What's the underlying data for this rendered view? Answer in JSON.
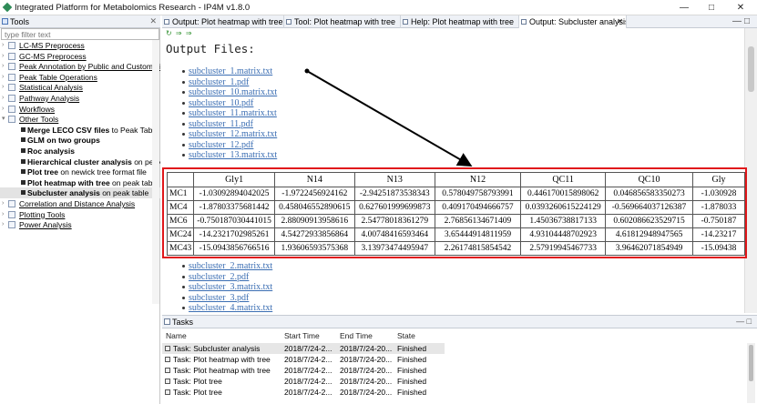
{
  "window": {
    "title": "Integrated Platform for Metabolomics Research - IP4M v1.8.0",
    "controls": [
      "—",
      "□",
      "✕"
    ]
  },
  "left_panel": {
    "tab_label": "Tools",
    "filter_placeholder": "type filter text",
    "tree": [
      {
        "label": "LC-MS Preprocess",
        "type": "folder",
        "level": 0
      },
      {
        "label": "GC-MS Preprocess",
        "type": "folder",
        "level": 0
      },
      {
        "label": "Peak Annotation by Public and Custom Li",
        "type": "folder",
        "level": 0
      },
      {
        "label": "Peak Table Operations",
        "type": "folder",
        "level": 0
      },
      {
        "label": "Statistical Analysis",
        "type": "folder",
        "level": 0
      },
      {
        "label": "Pathway Analysis",
        "type": "folder",
        "level": 0
      },
      {
        "label": "Workflows",
        "type": "folder",
        "level": 0
      },
      {
        "label": "Other Tools",
        "type": "folder",
        "level": 0,
        "expanded": true
      },
      {
        "bold": "Merge LECO CSV files",
        "rest": " to Peak Table",
        "type": "leaf",
        "level": 1
      },
      {
        "bold": "GLM on two groups",
        "rest": "",
        "type": "leaf",
        "level": 1
      },
      {
        "bold": "Roc analysis",
        "rest": "",
        "type": "leaf",
        "level": 1
      },
      {
        "bold": "Hierarchical cluster analysis",
        "rest": " on peak ta",
        "type": "leaf",
        "level": 1
      },
      {
        "bold": "Plot tree",
        "rest": " on newick tree format file",
        "type": "leaf",
        "level": 1
      },
      {
        "bold": "Plot heatmap with tree",
        "rest": " on peak table",
        "type": "leaf",
        "level": 1
      },
      {
        "bold": "Subcluster analysis",
        "rest": " on peak table",
        "type": "leaf",
        "level": 1,
        "selected": true
      },
      {
        "label": "Correlation and Distance Analysis",
        "type": "folder",
        "level": 0
      },
      {
        "label": "Plotting Tools",
        "type": "folder",
        "level": 0
      },
      {
        "label": "Power Analysis",
        "type": "folder",
        "level": 0
      }
    ]
  },
  "editor_tabs": [
    {
      "label": "Output: Plot heatmap with tree"
    },
    {
      "label": "Tool: Plot heatmap with tree"
    },
    {
      "label": "Help: Plot heatmap with tree"
    },
    {
      "label": "Output: Subcluster analysis",
      "active": true,
      "close": "✕"
    }
  ],
  "output": {
    "toolbar": "↻ ⇒ ⇒",
    "heading": "Output Files:",
    "files_top": [
      "subcluster_1.matrix.txt",
      "subcluster_1.pdf",
      "subcluster_10.matrix.txt",
      "subcluster_10.pdf",
      "subcluster_11.matrix.txt",
      "subcluster_11.pdf",
      "subcluster_12.matrix.txt",
      "subcluster_12.pdf",
      "subcluster_13.matrix.txt"
    ],
    "files_bottom": [
      "subcluster_2.matrix.txt",
      "subcluster_2.pdf",
      "subcluster_3.matrix.txt",
      "subcluster_3.pdf",
      "subcluster_4.matrix.txt"
    ]
  },
  "matrix_preview": {
    "columns": [
      "",
      "Gly1",
      "N14",
      "N13",
      "N12",
      "QC11",
      "QC10",
      "Gly"
    ],
    "rows": [
      [
        "MC1",
        "-1.03092894042025",
        "-1.9722456924162",
        "-2.94251873538343",
        "0.578049758793991",
        "0.446170015898062",
        "0.046856583350273",
        "-1.030928"
      ],
      [
        "MC4",
        "-1.87803375681442",
        "0.458046552890615",
        "0.627601999699873",
        "0.409170494666757",
        "0.0393260615224129",
        "-0.569664037126387",
        "-1.878033"
      ],
      [
        "MC6",
        "-0.750187030441015",
        "2.88090913958616",
        "2.54778018361279",
        "2.76856134671409",
        "1.45036738817133",
        "0.602086623529715",
        "-0.750187"
      ],
      [
        "MC24",
        "-14.2321702985261",
        "4.54272933856864",
        "4.00748416593464",
        "3.65444914811959",
        "4.93104448702923",
        "4.61812948947565",
        "-14.23217"
      ],
      [
        "MC43",
        "-15.0943856766516",
        "1.93606593575368",
        "3.13973474495947",
        "2.26174815854542",
        "2.57919945467733",
        "3.96462071854949",
        "-15.09438"
      ]
    ]
  },
  "tasks_panel": {
    "tab_label": "Tasks",
    "headers": [
      "Name",
      "Start Time",
      "End Time",
      "State"
    ],
    "rows": [
      {
        "name": "Task: Subcluster analysis",
        "start": "2018/7/24-2...",
        "end": "2018/7/24-20...",
        "state": "Finished",
        "selected": true
      },
      {
        "name": "Task: Plot heatmap with tree",
        "start": "2018/7/24-2...",
        "end": "2018/7/24-20...",
        "state": "Finished"
      },
      {
        "name": "Task: Plot heatmap with tree",
        "start": "2018/7/24-2...",
        "end": "2018/7/24-20...",
        "state": "Finished"
      },
      {
        "name": "Task: Plot tree",
        "start": "2018/7/24-2...",
        "end": "2018/7/24-20...",
        "state": "Finished"
      },
      {
        "name": "Task: Plot tree",
        "start": "2018/7/24-2...",
        "end": "2018/7/24-20...",
        "state": "Finished"
      }
    ]
  },
  "colors": {
    "annotation_box": "#e0181b",
    "link": "#3b6eb3",
    "annotation_arrow": "#000000"
  }
}
